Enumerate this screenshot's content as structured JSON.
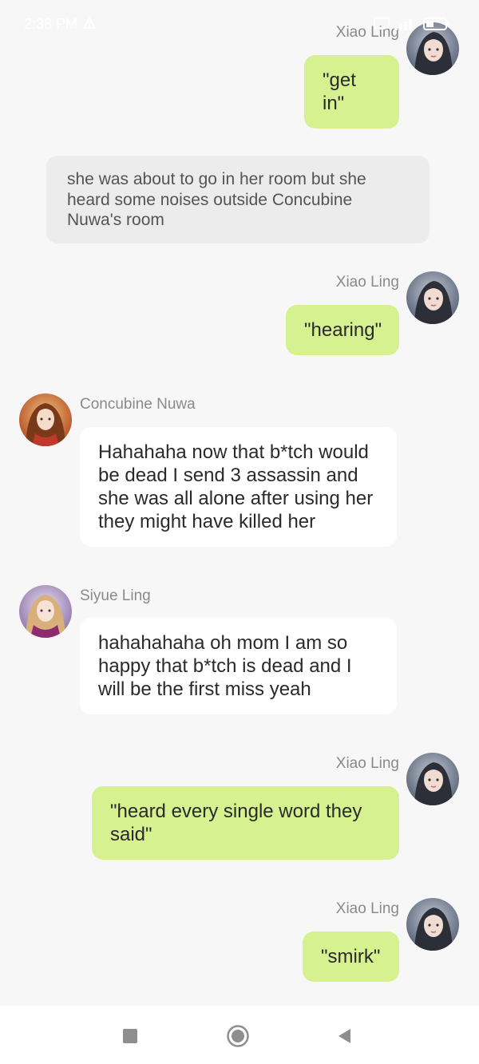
{
  "status_bar": {
    "time": "2:38 PM",
    "alert_icon": "warning-triangle-icon",
    "icons": [
      "screen-icon",
      "signal-icon",
      "battery-icon"
    ],
    "battery_level": 0.4
  },
  "messages": [
    {
      "type": "user",
      "sender": "Xiao Ling",
      "text": "\"get in\""
    },
    {
      "type": "narration",
      "text": "she was about to go in her room but she heard some noises outside Concubine Nuwa's room"
    },
    {
      "type": "user",
      "sender": "Xiao Ling",
      "text": "\"hearing\""
    },
    {
      "type": "character",
      "sender": "Concubine Nuwa",
      "text": "Hahahaha now that b*tch would be dead I send 3 assassin and she was all alone after using her they might have killed her"
    },
    {
      "type": "character",
      "sender": "Siyue Ling",
      "text": "hahahahaha oh mom I am so happy that b*tch is dead and I will be the first miss yeah"
    },
    {
      "type": "user",
      "sender": "Xiao Ling",
      "text": "\"heard every single word they said\""
    },
    {
      "type": "user",
      "sender": "Xiao Ling",
      "text": "\"smirk\""
    }
  ],
  "nav_bar": {
    "buttons": [
      "recents-square-icon",
      "home-circle-icon",
      "back-triangle-icon"
    ]
  },
  "colors": {
    "background": "#f7f7f7",
    "user_bubble": "#d6f18f",
    "character_bubble": "#ffffff",
    "narration_bubble": "#ececec",
    "name_text": "#8a8a8a"
  }
}
